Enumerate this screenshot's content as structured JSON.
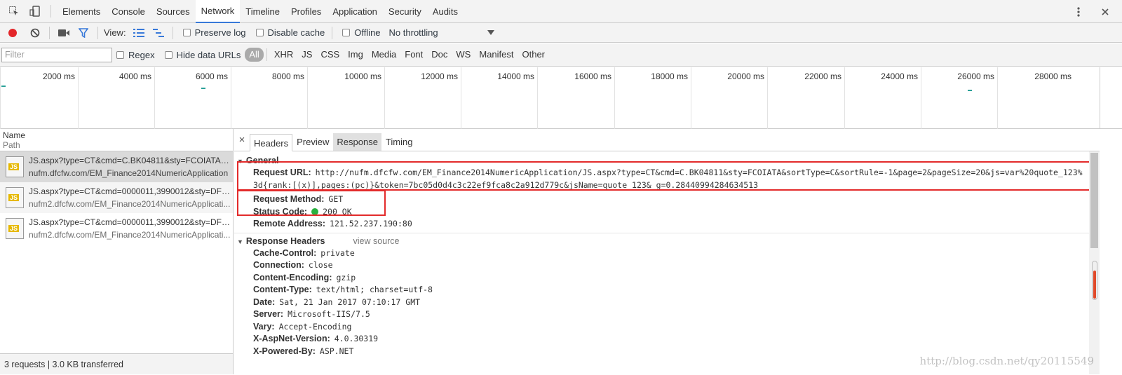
{
  "devtools_tabs": [
    "Elements",
    "Console",
    "Sources",
    "Network",
    "Timeline",
    "Profiles",
    "Application",
    "Security",
    "Audits"
  ],
  "active_tab": "Network",
  "toolbar": {
    "view_label": "View:",
    "preserve_log": "Preserve log",
    "disable_cache": "Disable cache",
    "offline": "Offline",
    "throttling": "No throttling"
  },
  "filterbar": {
    "placeholder": "Filter",
    "regex": "Regex",
    "hide_data_urls": "Hide data URLs",
    "types": [
      "All",
      "XHR",
      "JS",
      "CSS",
      "Img",
      "Media",
      "Font",
      "Doc",
      "WS",
      "Manifest",
      "Other"
    ]
  },
  "overview": {
    "ticks": [
      "2000 ms",
      "4000 ms",
      "6000 ms",
      "8000 ms",
      "10000 ms",
      "12000 ms",
      "14000 ms",
      "16000 ms",
      "18000 ms",
      "20000 ms",
      "22000 ms",
      "24000 ms",
      "26000 ms",
      "28000 ms"
    ]
  },
  "list": {
    "header_name": "Name",
    "header_path": "Path",
    "file_badge": "JS",
    "requests": [
      {
        "name": "JS.aspx?type=CT&cmd=C.BK04811&sty=FCOIATA&s...",
        "path": "nufm.dfcfw.com/EM_Finance2014NumericApplication"
      },
      {
        "name": "JS.aspx?type=CT&cmd=0000011,3990012&sty=DFPI...",
        "path": "nufm2.dfcfw.com/EM_Finance2014NumericApplicati..."
      },
      {
        "name": "JS.aspx?type=CT&cmd=0000011,3990012&sty=DFPI...",
        "path": "nufm2.dfcfw.com/EM_Finance2014NumericApplicati..."
      }
    ],
    "status": "3 requests  |  3.0 KB transferred"
  },
  "detail_tabs": [
    "Headers",
    "Preview",
    "Response",
    "Timing"
  ],
  "detail_close": "×",
  "general": {
    "title": "General",
    "request_url_label": "Request URL:",
    "request_url": "http://nufm.dfcfw.com/EM_Finance2014NumericApplication/JS.aspx?type=CT&cmd=C.BK04811&sty=FCOIATA&sortType=C&sortRule=-1&page=2&pageSize=20&js=var%20quote_123%3d{rank:[(x)],pages:(pc)}&token=7bc05d0d4c3c22ef9fca8c2a912d779c&jsName=quote_123&_g=0.28440994284634513",
    "method_label": "Request Method:",
    "method": "GET",
    "status_label": "Status Code:",
    "status": "200 OK",
    "remote_label": "Remote Address:",
    "remote": "121.52.237.190:80"
  },
  "response_headers": {
    "title": "Response Headers",
    "view_source": "view source",
    "items": [
      {
        "k": "Cache-Control:",
        "v": "private"
      },
      {
        "k": "Connection:",
        "v": "close"
      },
      {
        "k": "Content-Encoding:",
        "v": "gzip"
      },
      {
        "k": "Content-Type:",
        "v": "text/html; charset=utf-8"
      },
      {
        "k": "Date:",
        "v": "Sat, 21 Jan 2017 07:10:17 GMT"
      },
      {
        "k": "Server:",
        "v": "Microsoft-IIS/7.5"
      },
      {
        "k": "Vary:",
        "v": "Accept-Encoding"
      },
      {
        "k": "X-AspNet-Version:",
        "v": "4.0.30319"
      },
      {
        "k": "X-Powered-By:",
        "v": "ASP.NET"
      }
    ]
  },
  "watermark": "http://blog.csdn.net/qy20115549",
  "colors": {
    "accent": "#3879d9",
    "record": "#e3262a",
    "highlight": "#e32b2b",
    "ok": "#29b03f"
  }
}
